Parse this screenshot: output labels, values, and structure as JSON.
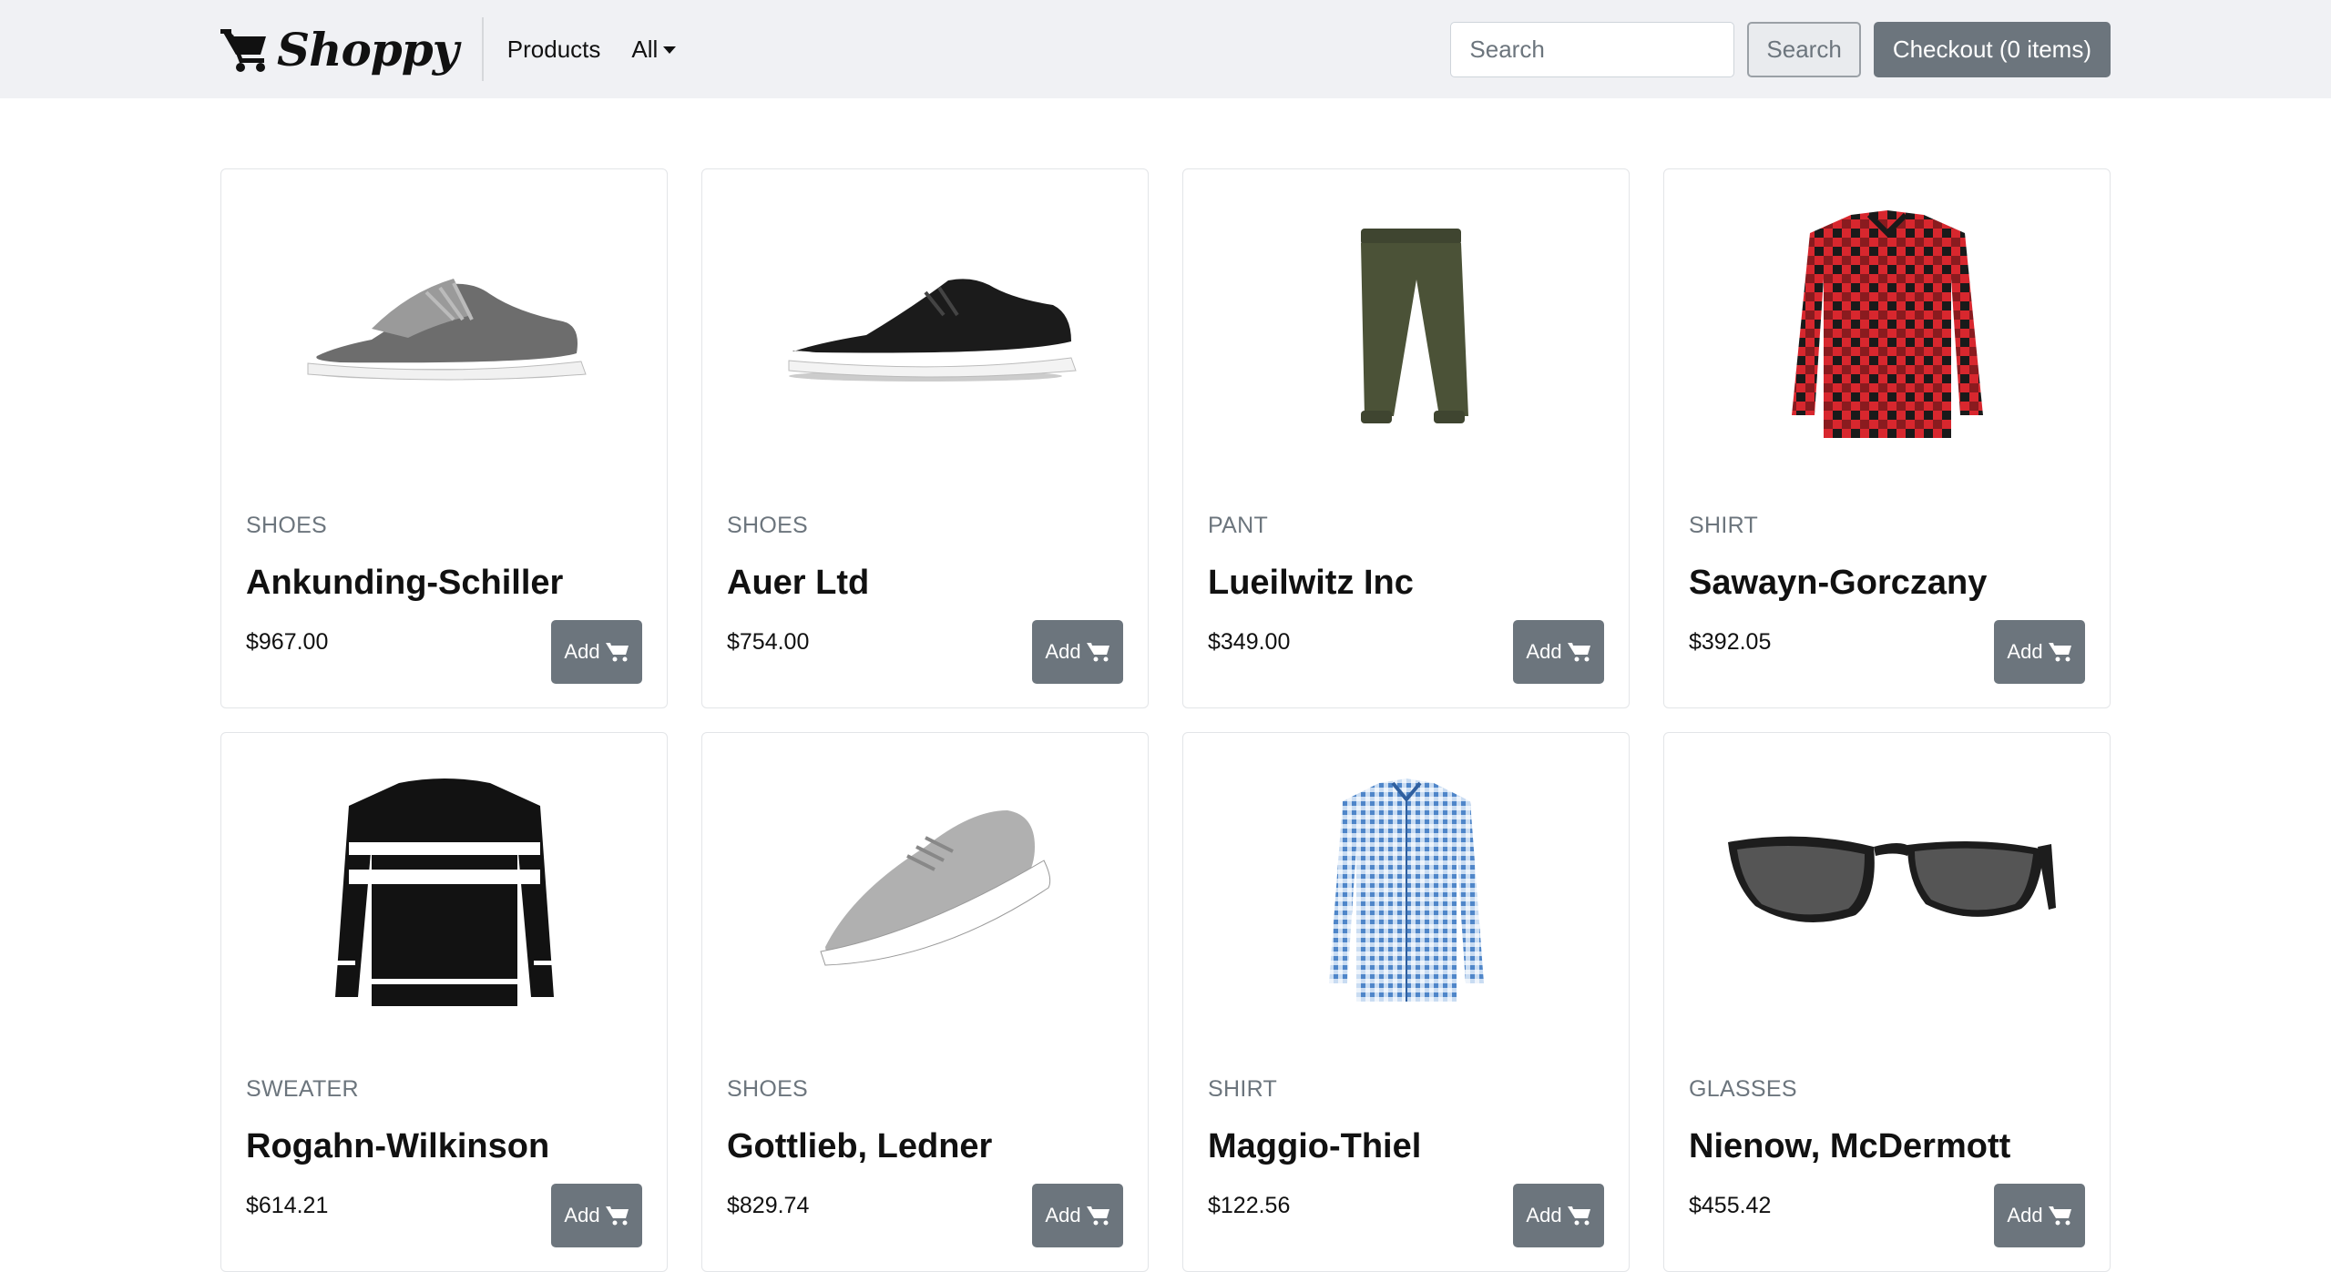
{
  "navbar": {
    "brand": "Shoppy",
    "brand_icon": "cart-icon",
    "products_link": "Products",
    "filter_dropdown": "All",
    "search_placeholder": "Search",
    "search_button": "Search",
    "checkout_button": "Checkout (0 items)"
  },
  "products": [
    {
      "category": "SHOES",
      "name": "Ankunding-Schiller",
      "price": "$967.00",
      "add_label": "Add",
      "image": "grey-knit-sneaker"
    },
    {
      "category": "SHOES",
      "name": "Auer Ltd",
      "price": "$754.00",
      "add_label": "Add",
      "image": "black-knit-sneaker"
    },
    {
      "category": "PANT",
      "name": "Lueilwitz Inc",
      "price": "$349.00",
      "add_label": "Add",
      "image": "olive-jogger-pants"
    },
    {
      "category": "SHIRT",
      "name": "Sawayn-Gorczany",
      "price": "$392.05",
      "add_label": "Add",
      "image": "red-black-plaid-shirt"
    },
    {
      "category": "SWEATER",
      "name": "Rogahn-Wilkinson",
      "price": "$614.21",
      "add_label": "Add",
      "image": "black-striped-sweater"
    },
    {
      "category": "SHOES",
      "name": "Gottlieb, Ledner",
      "price": "$829.74",
      "add_label": "Add",
      "image": "light-grey-sneaker"
    },
    {
      "category": "SHIRT",
      "name": "Maggio-Thiel",
      "price": "$122.56",
      "add_label": "Add",
      "image": "blue-gingham-shirt"
    },
    {
      "category": "GLASSES",
      "name": "Nienow, McDermott",
      "price": "$455.42",
      "add_label": "Add",
      "image": "black-sunglasses"
    }
  ]
}
